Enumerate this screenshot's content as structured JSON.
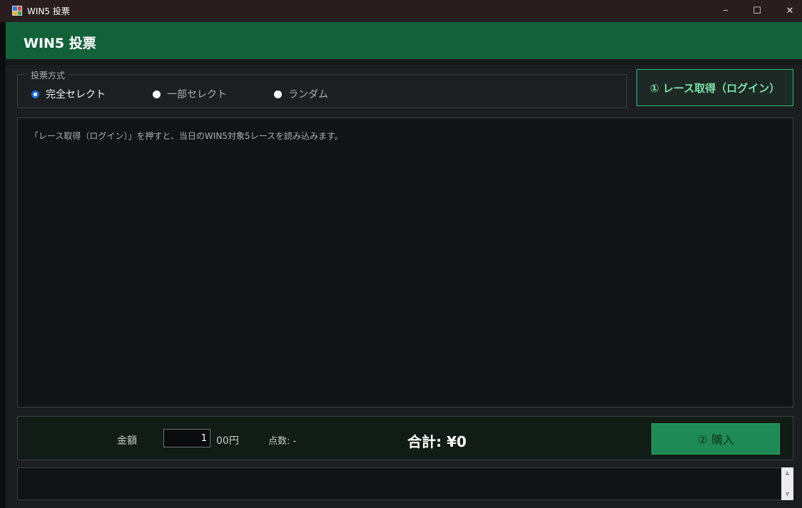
{
  "window": {
    "title": "WIN5 投票",
    "icon": "app-grid-icon",
    "min_glyph": "─",
    "max_glyph": "☐",
    "close_glyph": "✕"
  },
  "header": {
    "title": "WIN5 投票"
  },
  "vote_method": {
    "legend": "投票方式",
    "options": [
      {
        "label": "完全セレクト",
        "checked": true
      },
      {
        "label": "一部セレクト",
        "checked": false
      },
      {
        "label": "ランダム",
        "checked": false
      }
    ]
  },
  "fetch_button": {
    "label": "① レース取得（ログイン）"
  },
  "races_panel": {
    "message": "「レース取得（ログイン）」を押すと、当日のWIN5対象5レースを読み込みます。"
  },
  "bottom": {
    "amount_label": "金額",
    "amount_value": "1",
    "amount_unit": "00円",
    "points": "点数: -",
    "total": "合計: ¥0",
    "buy_label": "② 購入"
  },
  "log": {
    "scroll_up": "▲",
    "scroll_down": "▼"
  },
  "colors": {
    "header_green": "#12613b",
    "accent_green": "#2fbf74",
    "buy_green": "#1f8a55",
    "radio_blue": "#1d6fd0"
  }
}
